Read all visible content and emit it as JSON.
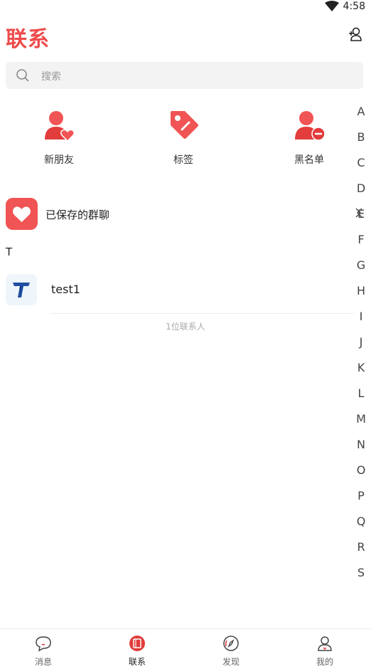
{
  "status_bar": {
    "time": "4:58"
  },
  "header": {
    "title": "联系"
  },
  "search": {
    "placeholder": "搜索"
  },
  "quick_actions": [
    {
      "label": "新朋友",
      "icon": "person-heart-icon"
    },
    {
      "label": "标签",
      "icon": "tag-icon"
    },
    {
      "label": "黑名单",
      "icon": "person-block-icon"
    }
  ],
  "saved_groups": {
    "label": "已保存的群聊"
  },
  "section": {
    "letter": "T"
  },
  "contacts": [
    {
      "name": "test1"
    }
  ],
  "contact_count": "1位联系人",
  "alpha_index": [
    "A",
    "B",
    "C",
    "D",
    "E",
    "F",
    "G",
    "H",
    "I",
    "J",
    "K",
    "L",
    "M",
    "N",
    "O",
    "P",
    "Q",
    "R",
    "S"
  ],
  "tabs": [
    {
      "label": "消息",
      "icon": "chat-icon",
      "active": false
    },
    {
      "label": "联系",
      "icon": "contacts-icon",
      "active": true
    },
    {
      "label": "发现",
      "icon": "compass-icon",
      "active": false
    },
    {
      "label": "我的",
      "icon": "profile-icon",
      "active": false
    }
  ],
  "colors": {
    "accent": "#ee4b4b",
    "icon_red": "#f05454",
    "avatar_blue": "#1f4fa0"
  }
}
